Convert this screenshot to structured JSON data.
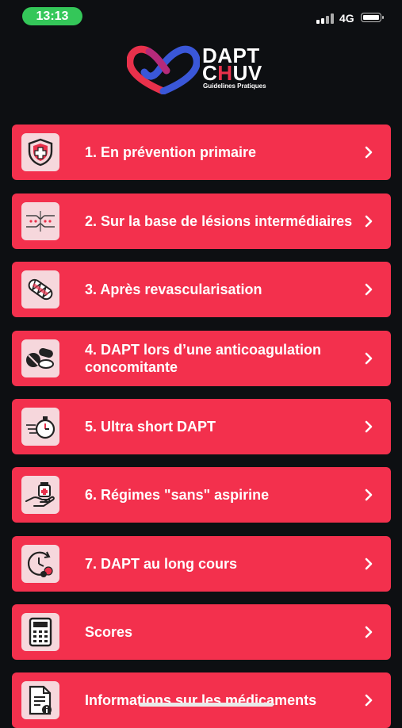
{
  "status_bar": {
    "time": "13:13",
    "network": "4G"
  },
  "logo": {
    "line1": "DAPT",
    "line2_a": "C",
    "line2_b": "H",
    "line2_c": "UV",
    "subtitle": "Guidelines Pratiques"
  },
  "menu": {
    "items": [
      {
        "label": "1. En prévention primaire",
        "icon": "shield-cross-icon"
      },
      {
        "label": "2. Sur la base de lésions intermédiaires",
        "icon": "artery-stenosis-icon"
      },
      {
        "label": "3. Après revascularisation",
        "icon": "stent-icon"
      },
      {
        "label": "4. DAPT lors d’une anticoagulation concomitante",
        "icon": "pills-icon"
      },
      {
        "label": "5. Ultra short DAPT",
        "icon": "stopwatch-icon"
      },
      {
        "label": "6. Régimes \"sans\" aspirine",
        "icon": "hand-medication-icon"
      },
      {
        "label": "7. DAPT au long cours",
        "icon": "clock-pill-icon"
      },
      {
        "label": "Scores",
        "icon": "calculator-icon"
      },
      {
        "label": "Informations sur les médicaments",
        "icon": "document-info-icon"
      }
    ]
  },
  "colors": {
    "background": "#0d0f12",
    "item_red": "#f3304d",
    "icon_box": "#f6d7dc",
    "status_green": "#34c759",
    "logo_red": "#e8314b",
    "logo_blue": "#3a57d8"
  }
}
